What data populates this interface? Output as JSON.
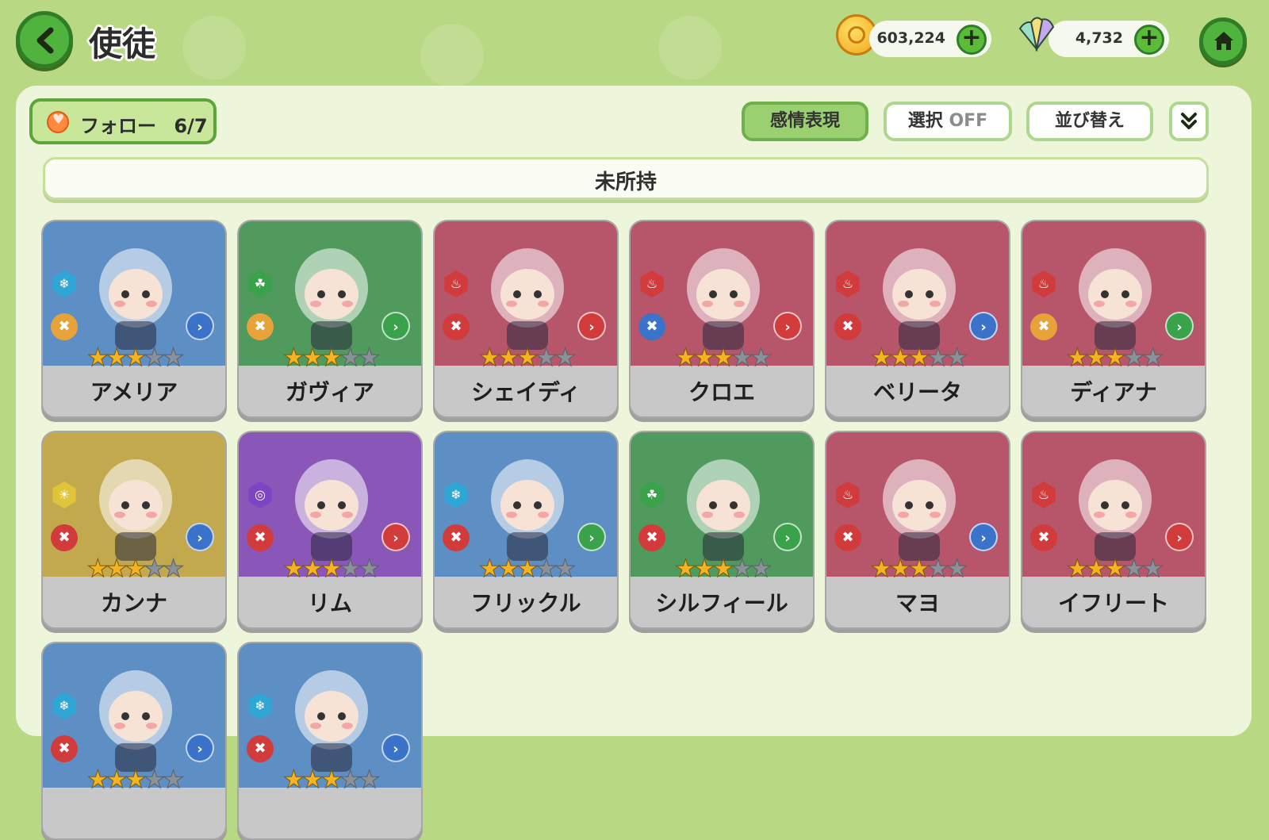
{
  "header": {
    "title": "使徒"
  },
  "currency": {
    "coins": "603,224",
    "gems": "4,732",
    "coin_icon": "gold-coin-icon",
    "gem_icon": "crystal-icon"
  },
  "toolbar": {
    "follow_label": "フォロー",
    "follow_count": "6/7",
    "emotion_label": "感情表現",
    "select_label": "選択",
    "select_state": "OFF",
    "sort_label": "並び替え"
  },
  "section": {
    "title": "未所持"
  },
  "characters": [
    {
      "name": "アメリア",
      "bg": "#5d8fc4",
      "element": "ice",
      "elem_color": "#2fa6d4",
      "class_color": "#e7a33a",
      "pos_color": "#3a73c9",
      "stars": 3
    },
    {
      "name": "ガヴィア",
      "bg": "#4f9a5c",
      "element": "wind",
      "elem_color": "#3aa24b",
      "class_color": "#e7a33a",
      "pos_color": "#3aa24b",
      "stars": 3
    },
    {
      "name": "シェイディ",
      "bg": "#b7556b",
      "element": "fire",
      "elem_color": "#d23b3b",
      "class_color": "#d23b3b",
      "pos_color": "#d23b3b",
      "stars": 3
    },
    {
      "name": "クロエ",
      "bg": "#b7556b",
      "element": "fire",
      "elem_color": "#d23b3b",
      "class_color": "#3a73c9",
      "pos_color": "#d23b3b",
      "stars": 3
    },
    {
      "name": "ベリータ",
      "bg": "#b7556b",
      "element": "fire",
      "elem_color": "#d23b3b",
      "class_color": "#d23b3b",
      "pos_color": "#3a73c9",
      "stars": 3
    },
    {
      "name": "ディアナ",
      "bg": "#b7556b",
      "element": "fire",
      "elem_color": "#d23b3b",
      "class_color": "#e7a33a",
      "pos_color": "#3aa24b",
      "stars": 3
    },
    {
      "name": "カンナ",
      "bg": "#c2a94e",
      "element": "light",
      "elem_color": "#e0c43b",
      "class_color": "#d23b3b",
      "pos_color": "#3a73c9",
      "stars": 3
    },
    {
      "name": "リム",
      "bg": "#8a56b8",
      "element": "dark",
      "elem_color": "#7b45c4",
      "class_color": "#d23b3b",
      "pos_color": "#d23b3b",
      "stars": 3
    },
    {
      "name": "フリックル",
      "bg": "#5d8fc4",
      "element": "ice",
      "elem_color": "#2fa6d4",
      "class_color": "#d23b3b",
      "pos_color": "#3aa24b",
      "stars": 3
    },
    {
      "name": "シルフィール",
      "bg": "#4f9a5c",
      "element": "wind",
      "elem_color": "#3aa24b",
      "class_color": "#d23b3b",
      "pos_color": "#3aa24b",
      "stars": 3
    },
    {
      "name": "マヨ",
      "bg": "#b7556b",
      "element": "fire",
      "elem_color": "#d23b3b",
      "class_color": "#d23b3b",
      "pos_color": "#3a73c9",
      "stars": 3
    },
    {
      "name": "イフリート",
      "bg": "#b7556b",
      "element": "fire",
      "elem_color": "#d23b3b",
      "class_color": "#d23b3b",
      "pos_color": "#d23b3b",
      "stars": 3
    },
    {
      "name": "",
      "bg": "#5d8fc4",
      "element": "ice",
      "elem_color": "#2fa6d4",
      "class_color": "#d23b3b",
      "pos_color": "#3a73c9",
      "stars": 3
    },
    {
      "name": "",
      "bg": "#5d8fc4",
      "element": "ice",
      "elem_color": "#2fa6d4",
      "class_color": "#d23b3b",
      "pos_color": "#3a73c9",
      "stars": 3
    }
  ]
}
